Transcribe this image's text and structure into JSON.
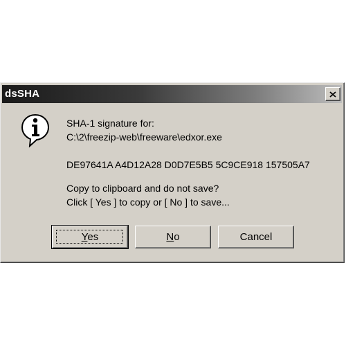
{
  "window": {
    "title": "dsSHA",
    "close_glyph": "x"
  },
  "icon": {
    "name": "information-icon",
    "glyph": "i"
  },
  "message": {
    "line1": "SHA-1 signature for:",
    "line2": "C:\\2\\freezip-web\\freeware\\edxor.exe",
    "signature": "DE97641A A4D12A28 D0D7E5B5 5C9CE918 157505A7",
    "line4": "Copy to clipboard and do not save?",
    "line5": "Click  [ Yes ]  to copy or  [ No ]  to save..."
  },
  "buttons": {
    "yes_label": "Yes",
    "no_label": "No",
    "cancel_label": "Cancel"
  }
}
